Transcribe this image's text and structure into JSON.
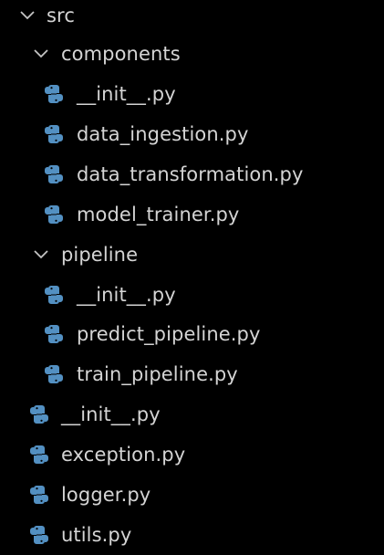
{
  "explorer": {
    "colors": {
      "background": "#000000",
      "text": "#d4d4d4",
      "chevron": "#c5c5c5",
      "python_icon": "#5390c2"
    },
    "items": [
      {
        "label": "src",
        "type": "folder",
        "expanded": true,
        "icon": "chevron-down-icon"
      },
      {
        "label": "components",
        "type": "folder",
        "expanded": true,
        "icon": "chevron-down-icon"
      },
      {
        "label": "__init__.py",
        "type": "file",
        "icon": "python-file-icon"
      },
      {
        "label": "data_ingestion.py",
        "type": "file",
        "icon": "python-file-icon"
      },
      {
        "label": "data_transformation.py",
        "type": "file",
        "icon": "python-file-icon"
      },
      {
        "label": "model_trainer.py",
        "type": "file",
        "icon": "python-file-icon"
      },
      {
        "label": "pipeline",
        "type": "folder",
        "expanded": true,
        "icon": "chevron-down-icon"
      },
      {
        "label": "__init__.py",
        "type": "file",
        "icon": "python-file-icon"
      },
      {
        "label": "predict_pipeline.py",
        "type": "file",
        "icon": "python-file-icon"
      },
      {
        "label": "train_pipeline.py",
        "type": "file",
        "icon": "python-file-icon"
      },
      {
        "label": "__init__.py",
        "type": "file",
        "icon": "python-file-icon"
      },
      {
        "label": "exception.py",
        "type": "file",
        "icon": "python-file-icon"
      },
      {
        "label": "logger.py",
        "type": "file",
        "icon": "python-file-icon"
      },
      {
        "label": "utils.py",
        "type": "file",
        "icon": "python-file-icon"
      }
    ]
  }
}
